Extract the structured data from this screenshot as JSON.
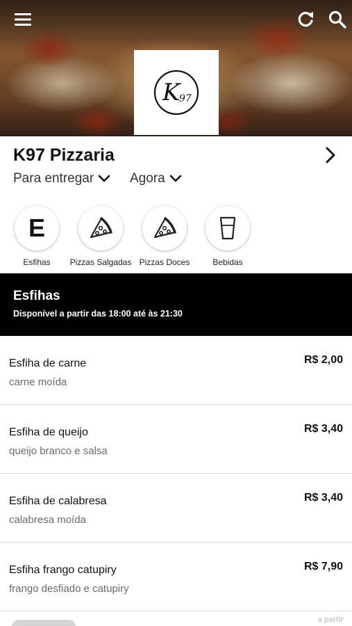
{
  "header": {
    "menu_icon": "hamburger-menu-icon",
    "refresh_icon": "refresh-icon",
    "search_icon": "search-icon",
    "logo_text": "K97"
  },
  "store": {
    "name": "K97 Pizzaria",
    "delivery_mode": "Para entregar",
    "time_mode": "Agora"
  },
  "categories": [
    {
      "label": "Esfihas",
      "icon": "letter-e-icon",
      "letter": "E"
    },
    {
      "label": "Pizzas Salgadas",
      "icon": "pizza-slice-icon"
    },
    {
      "label": "Pizzas Doces",
      "icon": "pizza-slice-icon"
    },
    {
      "label": "Bebidas",
      "icon": "drink-cup-icon"
    }
  ],
  "section": {
    "title": "Esfihas",
    "availability": "Disponível a partir das 18:00 até às 21:30"
  },
  "items": [
    {
      "name": "Esfiha de carne",
      "description": "carne moída",
      "price": "R$ 2,00"
    },
    {
      "name": "Esfiha de queijo",
      "description": "queijo branco e salsa",
      "price": "R$ 3,40"
    },
    {
      "name": "Esfiha de calabresa",
      "description": "calabresa moída",
      "price": "R$ 3,40"
    },
    {
      "name": "Esfiha frango catupiry",
      "description": "frango desfiado e catupiry",
      "price": "R$ 7,90"
    }
  ],
  "footer_hint": "a partir",
  "colors": {
    "banner_bg": "#000000",
    "text_primary": "#111111",
    "text_secondary": "#6b6b6b"
  }
}
